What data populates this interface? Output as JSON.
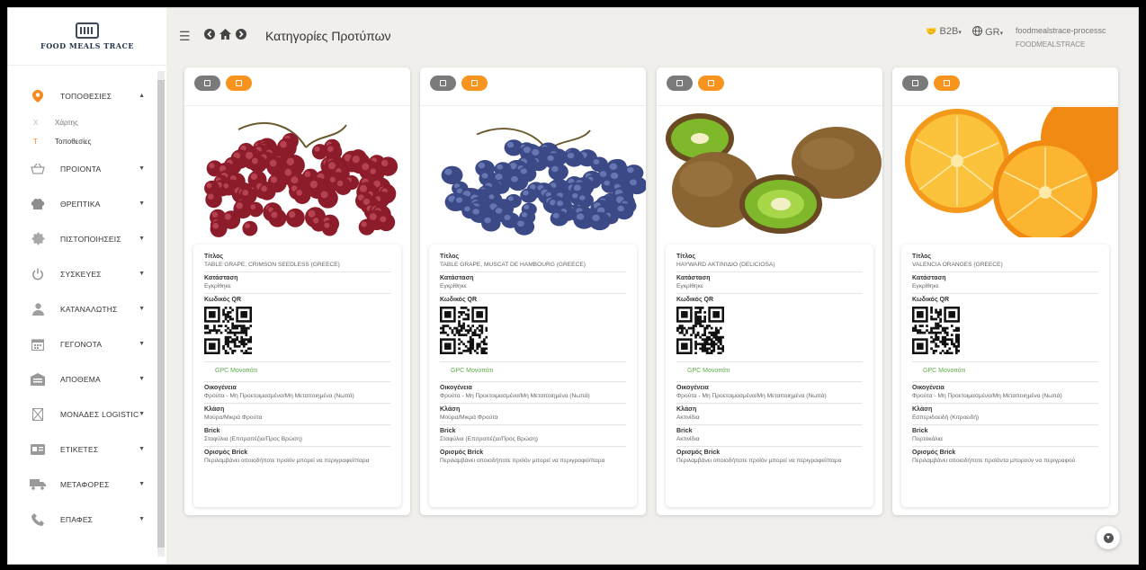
{
  "brand": {
    "name": "FOOD MEALS TRACE"
  },
  "header": {
    "title": "Κατηγορίες Προτύπων",
    "b2b_label": "B2B",
    "lang_label": "GR",
    "user": "foodmealstrace-processc",
    "org": "FOODMEALSTRACE"
  },
  "sidebar": {
    "items": [
      {
        "label": "ΤΟΠΟΘΕΣΙΕΣ",
        "icon": "map-pin-icon",
        "active": true
      },
      {
        "label": "ΠΡΟΙΟΝΤΑ",
        "icon": "basket-icon"
      },
      {
        "label": "ΘΡΕΠΤΙΚΑ",
        "icon": "chef-hat-icon"
      },
      {
        "label": "ΠΙΣΤΟΠΟΙΗΣΕΙΣ",
        "icon": "badge-icon"
      },
      {
        "label": "ΣΥΣΚΕΥΕΣ",
        "icon": "power-icon"
      },
      {
        "label": "ΚΑΤΑΝΑΛΩΤΗΣ",
        "icon": "user-icon"
      },
      {
        "label": "ΓΕΓΟΝΟΤΑ",
        "icon": "calendar-icon"
      },
      {
        "label": "ΑΠΟΘΕΜΑ",
        "icon": "warehouse-icon"
      },
      {
        "label": "ΜΟΝΑΔΕΣ LOGISTIC",
        "icon": "box-icon"
      },
      {
        "label": "ΕΤΙΚΕΤΕΣ",
        "icon": "id-card-icon"
      },
      {
        "label": "ΜΕΤΑΦΟΡΕΣ",
        "icon": "truck-icon"
      },
      {
        "label": "ΕΠΑΦΕΣ",
        "icon": "phone-icon"
      }
    ],
    "subitems": [
      {
        "letter": "X",
        "label": "Χάρτης"
      },
      {
        "letter": "T",
        "label": "Τοποθεσίες",
        "active": true
      }
    ]
  },
  "field_labels": {
    "title": "Τίτλος",
    "status": "Κατάσταση",
    "qr": "Κωδικός QR",
    "gpc": "GPC Μονοπάτι",
    "family": "Οικογένεια",
    "class": "Κλάση",
    "brick": "Brick",
    "brick_def": "Ορισμός Brick"
  },
  "cards": [
    {
      "image": "red-grapes",
      "title": "TABLE GRAPE, CRIMSON SEEDLESS (GREECE)",
      "status": "Εγκρίθηκε",
      "family": "Φρούτα - Μη Προετοιμασμένα/Μη Μεταποιημένα (Νωπά)",
      "class": "Μούρα/Μικρά Φρούτα",
      "brick": "Σταφύλια (Επιτραπέζια/Προς Βρώση)",
      "brick_def": "Περιλαμβάνει οποιοδήποτε προϊόν μπορεί να περιγραφεί/παρα"
    },
    {
      "image": "blue-grapes",
      "title": "TABLE GRAPE, MUSCAT DE HAMBOURG (GREECE)",
      "status": "Εγκρίθηκε",
      "family": "Φρούτα - Μη Προετοιμασμένα/Μη Μεταποιημένα (Νωπά)",
      "class": "Μούρα/Μικρά Φρούτα",
      "brick": "Σταφύλια (Επιτραπέζια/Προς Βρώση)",
      "brick_def": "Περιλαμβάνει οποιοδήποτε προϊόν μπορεί να περιγραφεί/παρα"
    },
    {
      "image": "kiwi",
      "title": "HAYWARD Ακτινίδιο (DELICIOSA)",
      "status": "Εγκρίθηκε",
      "family": "Φρούτα - Μη Προετοιμασμένα/Μη Μεταποιημένα (Νωπά)",
      "class": "Ακτινίδια",
      "brick": "Ακτινίδια",
      "brick_def": "Περιλαμβάνει οποιοδήποτε προϊόν μπορεί να περιγραφεί/παρα"
    },
    {
      "image": "oranges",
      "title": "VALENCIA ORANGES (GREECE)",
      "status": "Εγκρίθηκε",
      "family": "Φρούτα - Μη Προετοιμασμένα/Μη Μεταποιημένα (Νωπά)",
      "class": "Εσπεριδοειδή (Κιτροειδή)",
      "brick": "Πορτοκάλια",
      "brick_def": "Περιλαμβάνει οποιοδήποτε προϊόντα μπορούν να περιγραφού"
    }
  ],
  "colors": {
    "accent": "#f7941d",
    "gpc": "#5cab4a",
    "edit": "#7a7a7a"
  }
}
